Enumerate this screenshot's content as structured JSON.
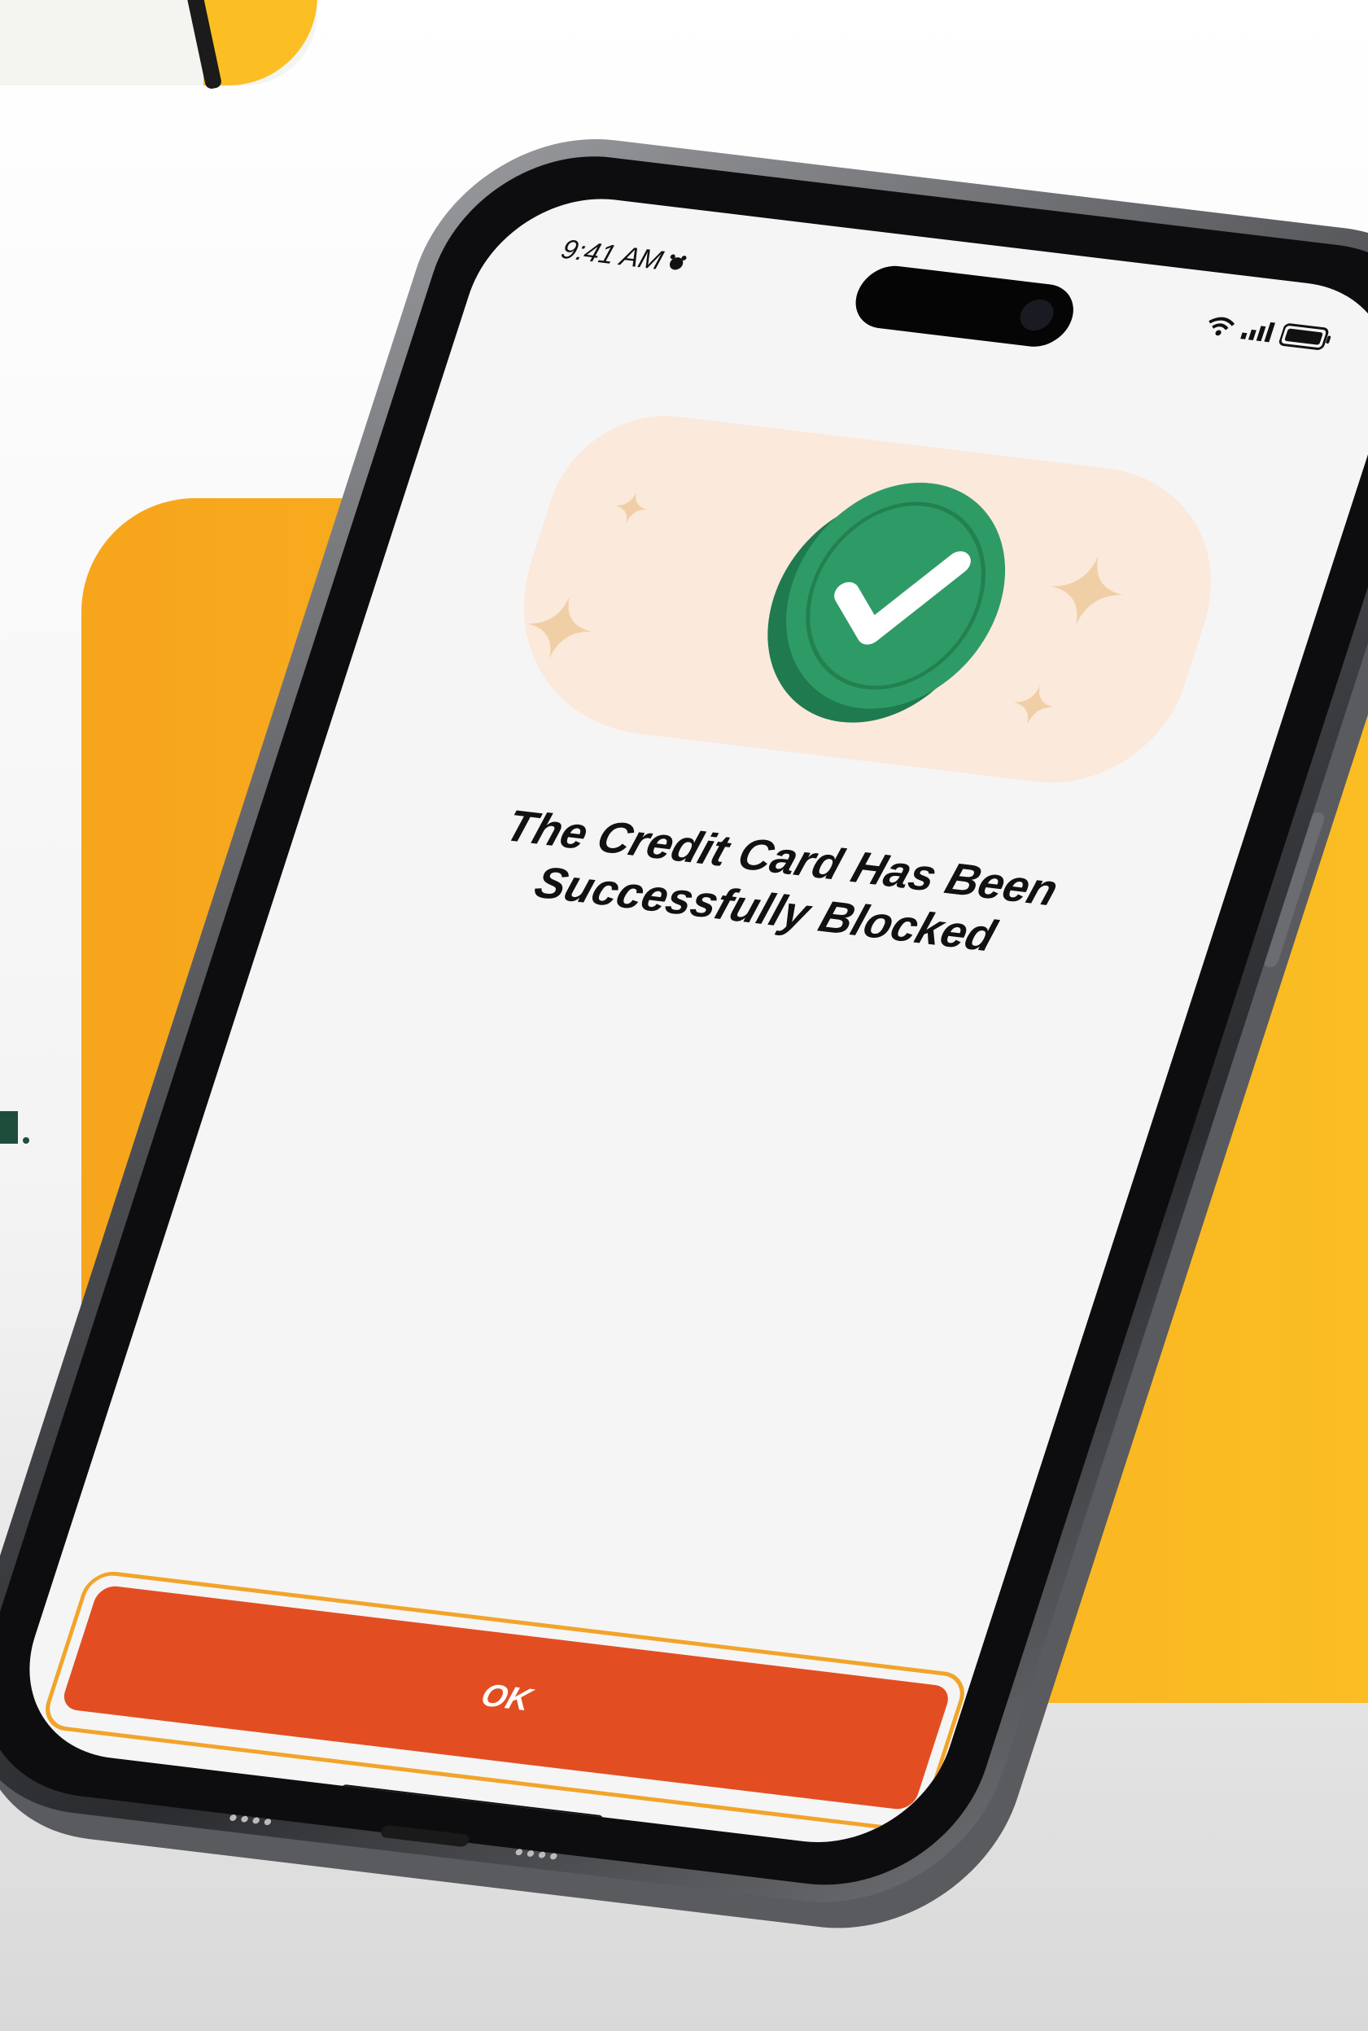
{
  "status_bar": {
    "time": "9:41 AM",
    "alarm_icon": "alarm-icon",
    "wifi_icon": "wifi-icon",
    "signal_icon": "cellular-signal-icon",
    "battery_icon": "battery-icon"
  },
  "illustration": {
    "icon": "checkmark-badge-icon",
    "badge_color": "#2e9b67",
    "badge_dark_color": "#1f7a4f",
    "background_color": "#fbe9dc"
  },
  "message": {
    "line1": "The Credit Card Has Been",
    "line2": "Successfully Blocked"
  },
  "actions": {
    "ok_label": "OK",
    "ok_color": "#e24e22"
  },
  "colors": {
    "accent_orange": "#f7a51c",
    "accent_yellow": "#fbbf24",
    "screen_bg": "#f5f5f5"
  }
}
